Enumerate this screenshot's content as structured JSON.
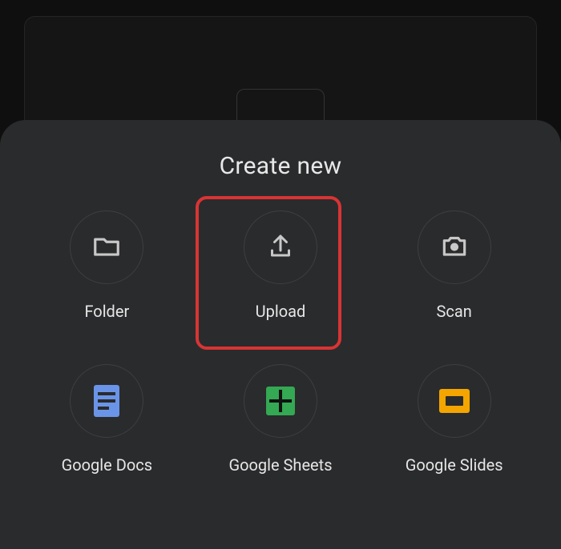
{
  "sheet": {
    "title": "Create new"
  },
  "actions": {
    "folder": {
      "label": "Folder"
    },
    "upload": {
      "label": "Upload"
    },
    "scan": {
      "label": "Scan"
    },
    "docs": {
      "label": "Google Docs"
    },
    "sheets": {
      "label": "Google Sheets"
    },
    "slides": {
      "label": "Google Slides"
    }
  },
  "highlighted": "upload"
}
